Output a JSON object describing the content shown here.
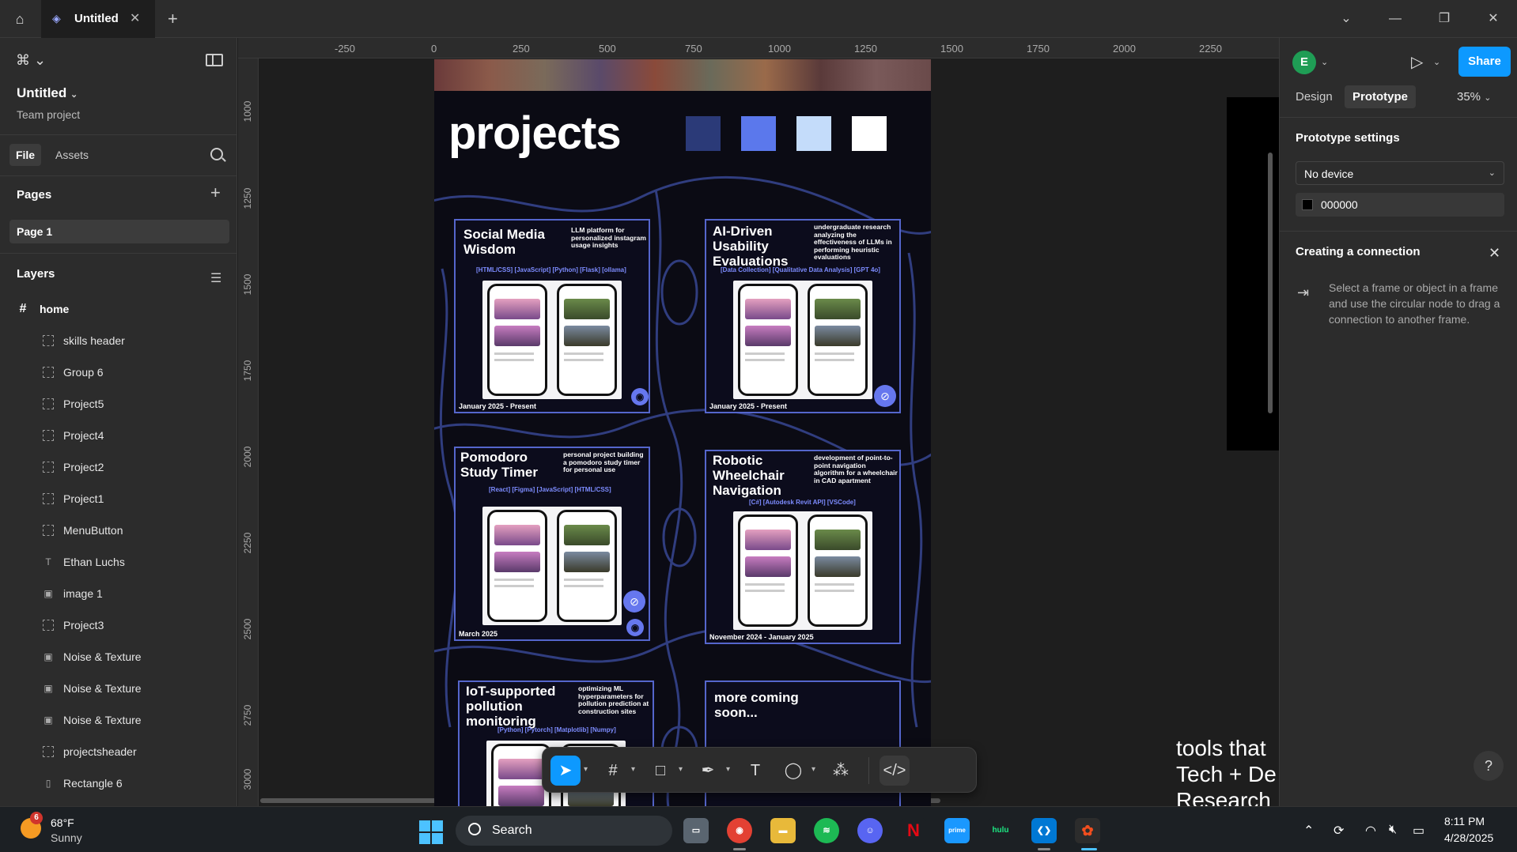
{
  "tab": {
    "title": "Untitled"
  },
  "file": {
    "title": "Untitled",
    "subtitle": "Team project"
  },
  "left_tabs": {
    "file": "File",
    "assets": "Assets"
  },
  "pages": {
    "title": "Pages",
    "items": [
      "Page 1"
    ]
  },
  "layers": {
    "title": "Layers",
    "root": "home",
    "items": [
      {
        "label": "skills header",
        "icon": "frame-dashed-icon"
      },
      {
        "label": "Group 6",
        "icon": "frame-dashed-icon"
      },
      {
        "label": "Project5",
        "icon": "frame-dashed-icon"
      },
      {
        "label": "Project4",
        "icon": "frame-dashed-icon"
      },
      {
        "label": "Project2",
        "icon": "frame-dashed-icon"
      },
      {
        "label": "Project1",
        "icon": "frame-dashed-icon"
      },
      {
        "label": "MenuButton",
        "icon": "frame-dashed-icon"
      },
      {
        "label": "Ethan Luchs",
        "icon": "text-icon"
      },
      {
        "label": "image 1",
        "icon": "image-icon"
      },
      {
        "label": "Project3",
        "icon": "frame-dashed-icon"
      },
      {
        "label": "Noise & Texture",
        "icon": "image-icon"
      },
      {
        "label": "Noise & Texture",
        "icon": "image-icon"
      },
      {
        "label": "Noise & Texture",
        "icon": "image-icon"
      },
      {
        "label": "projectsheader",
        "icon": "frame-dashed-icon"
      },
      {
        "label": "Rectangle 6",
        "icon": "rectangle-icon"
      }
    ]
  },
  "ruler_top": [
    "-250",
    "0",
    "250",
    "500",
    "750",
    "1000",
    "1250",
    "1500",
    "1750",
    "2000",
    "2250"
  ],
  "ruler_left": [
    "1000",
    "1250",
    "1500",
    "1750",
    "2000",
    "2250",
    "2500",
    "2750",
    "3000"
  ],
  "design": {
    "heading": "projects",
    "swatches": [
      "#2b3a78",
      "#5b78ec",
      "#c4dcfa",
      "#ffffff"
    ],
    "cards": [
      {
        "title": "Social Media Wisdom",
        "desc": "LLM platform for personalized instagram usage insights",
        "tags": "[HTML/CSS] [JavaScript] [Python] [Flask] [ollama]",
        "date": "January 2025 - Present"
      },
      {
        "title": "AI-Driven Usability Evaluations",
        "desc": "undergraduate research analyzing the effectiveness of LLMs in performing heuristic evaluations",
        "tags": "[Data Collection] [Qualitative Data Analysis] [GPT 4o]",
        "date": "January 2025 - Present"
      },
      {
        "title": "Pomodoro Study Timer",
        "desc": "personal project building a pomodoro study timer for personal use",
        "tags": "[React] [Figma] [JavaScript] [HTML/CSS]",
        "date": "March 2025"
      },
      {
        "title": "Robotic Wheelchair Navigation",
        "desc": "development of point-to-point navigation algorithm for a wheelchair in CAD apartment",
        "tags": "[C#] [Autodesk Revit API] [VSCode]",
        "date": "November 2024 - January 2025"
      },
      {
        "title": "IoT-supported pollution monitoring",
        "desc": "optimizing ML hyperparameters for pollution prediction at construction sites",
        "tags": "[Python] [Pytorch] [Matplotlib] [Numpy]",
        "date": ""
      },
      {
        "title": "more coming soon...",
        "desc": "",
        "tags": "",
        "date": ""
      }
    ]
  },
  "canvas_text": [
    "tools that",
    "Tech + De",
    "Research"
  ],
  "right": {
    "avatar": "E",
    "share": "Share",
    "tab_design": "Design",
    "tab_prototype": "Prototype",
    "zoom": "35%",
    "proto_settings": "Prototype settings",
    "device": "No device",
    "bg_color": "000000",
    "conn_title": "Creating a connection",
    "conn_text": "Select a frame or object in a frame and use the circular node to drag a connection to another frame."
  },
  "taskbar": {
    "weather_badge": "6",
    "temp": "68°F",
    "condition": "Sunny",
    "search": "Search",
    "time": "8:11 PM",
    "date": "4/28/2025"
  }
}
